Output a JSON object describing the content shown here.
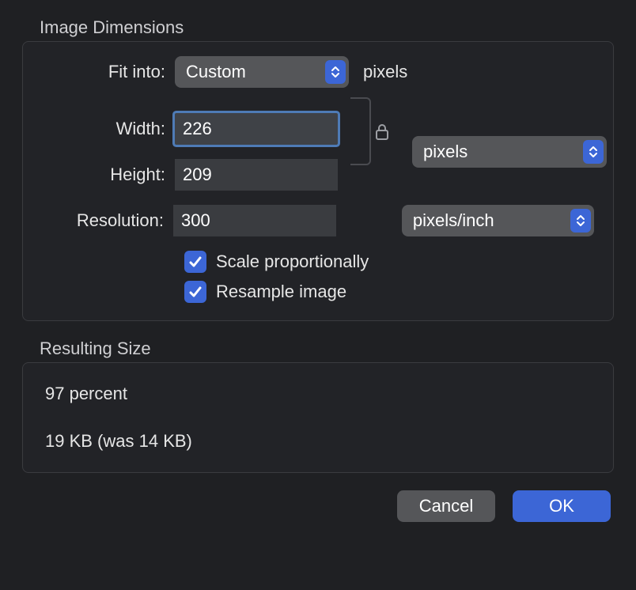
{
  "dimensions": {
    "section_label": "Image Dimensions",
    "fit_into_label": "Fit into:",
    "fit_into_value": "Custom",
    "fit_into_unit": "pixels",
    "width_label": "Width:",
    "width_value": "226",
    "height_label": "Height:",
    "height_value": "209",
    "wh_unit_value": "pixels",
    "resolution_label": "Resolution:",
    "resolution_value": "300",
    "resolution_unit_value": "pixels/inch",
    "scale_label": "Scale proportionally",
    "scale_checked": true,
    "resample_label": "Resample image",
    "resample_checked": true
  },
  "result": {
    "section_label": "Resulting Size",
    "percent_text": "97 percent",
    "size_text": "19 KB (was 14 KB)"
  },
  "buttons": {
    "cancel": "Cancel",
    "ok": "OK"
  }
}
